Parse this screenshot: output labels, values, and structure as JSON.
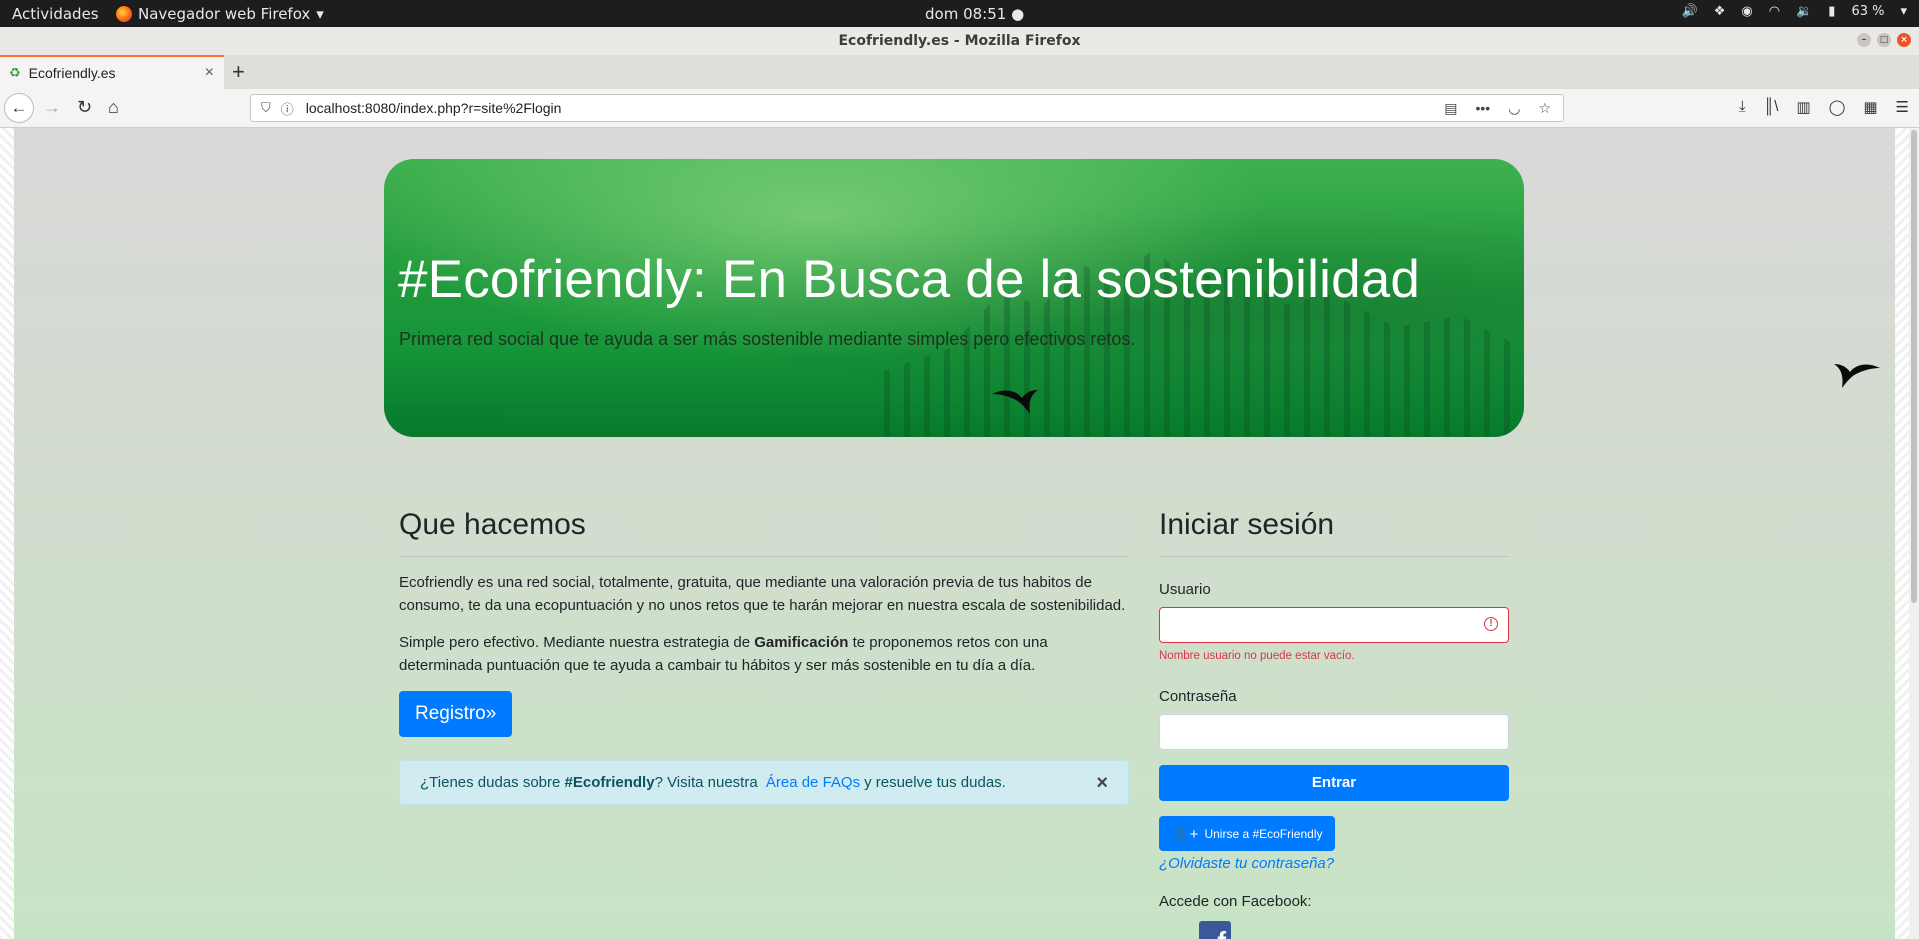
{
  "system": {
    "activities": "Actividades",
    "app_menu": "Navegador web Firefox",
    "clock": "dom 08:51",
    "battery": "63 %"
  },
  "window": {
    "title": "Ecofriendly.es - Mozilla Firefox"
  },
  "tab": {
    "label": "Ecofriendly.es"
  },
  "navigation": {
    "url": "localhost:8080/index.php?r=site%2Flogin"
  },
  "hero": {
    "title": "#Ecofriendly: En Busca de la sostenibilidad",
    "subtitle": "Primera red social que te ayuda a ser más sostenible mediante simples pero efectivos retos."
  },
  "about": {
    "heading": "Que hacemos",
    "paragraph1": "Ecofriendly es una red social, totalmente, gratuita, que mediante una valoración previa de tus habitos de consumo, te da una ecopuntuación y no unos retos que te harán mejorar en nuestra escala de sostenibilidad.",
    "paragraph2_before": "Simple pero efectivo. Mediante nuestra estrategia de ",
    "paragraph2_bold": "Gamificación",
    "paragraph2_after": " te proponemos retos con una determinada puntuación que te ayuda a cambair tu hábitos y ser más sostenible en tu día a día.",
    "register_button": "Registro»"
  },
  "alert": {
    "text_before": "¿Tienes dudas sobre ",
    "text_bold": "#Ecofriendly",
    "text_middle": "? Visita nuestra ",
    "link": "Área de FAQs",
    "text_after": " y resuelve tus dudas.",
    "close": "×"
  },
  "login": {
    "heading": "Iniciar sesión",
    "user_label": "Usuario",
    "user_value": "",
    "user_error": "Nombre usuario no puede estar vacío.",
    "password_label": "Contraseña",
    "password_value": "",
    "submit": "Entrar",
    "join_button": "Unirse a #EcoFriendly",
    "forgot": "¿Olvidaste tu contraseña?",
    "facebook_label": "Accede con Facebook:",
    "facebook_icon": "f"
  },
  "colors": {
    "primary": "#007bff",
    "danger": "#dc3545",
    "hero_green": "#1f9a3c",
    "alert_bg": "#d1ecf1"
  }
}
